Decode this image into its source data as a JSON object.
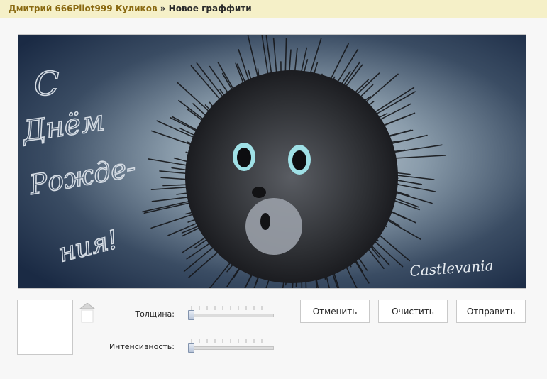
{
  "breadcrumb": {
    "user_name": "Дмитрий 666Pilot999 Куликов",
    "separator": "»",
    "current": "Новое граффити"
  },
  "canvas": {
    "greeting_text": [
      "С",
      "Днём",
      "Рожде-",
      "ния!"
    ],
    "signature": "Castlevania"
  },
  "controls": {
    "thickness_label": "Толщина:",
    "thickness_value": 0,
    "intensity_label": "Интенсивность:",
    "intensity_value": 0
  },
  "buttons": {
    "cancel": "Отменить",
    "clear": "Очистить",
    "send": "Отправить"
  },
  "colors": {
    "link": "#8a6a12",
    "header_bg": "#f5f0c8"
  }
}
